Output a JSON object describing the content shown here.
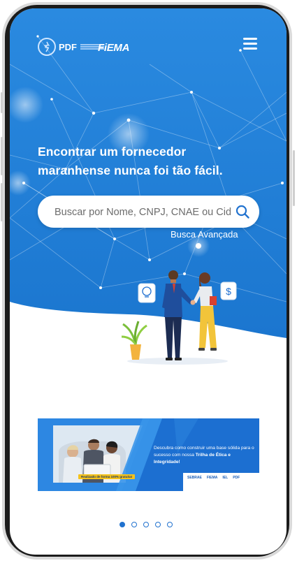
{
  "colors": {
    "primary": "#1f7fd8",
    "accent": "#2172cf",
    "white": "#ffffff"
  },
  "header": {
    "logo_pdf_text": "PDF",
    "logo_fiema_text": "FiEMA",
    "menu_icon": "hamburger-menu-icon"
  },
  "hero": {
    "headline_line1": "Encontrar um fornecedor",
    "headline_line2": "maranhense nunca foi tão fácil.",
    "search": {
      "placeholder": "Buscar por Nome, CNPJ, CNAE ou Cidade",
      "value": "",
      "icon": "search-icon"
    },
    "advanced_search_label": "Busca Avançada"
  },
  "banner": {
    "text_prefix": "Descubra como construir uma base sólida para o sucesso com nossa ",
    "text_bold": "Trilha de Ética e Integridade!",
    "badge": "Realizado de forma 100% gratuita!",
    "logos": [
      "SEBRAE",
      "FIEMA",
      "IEL",
      "PDF"
    ]
  },
  "carousel": {
    "total": 5,
    "active_index": 0
  }
}
